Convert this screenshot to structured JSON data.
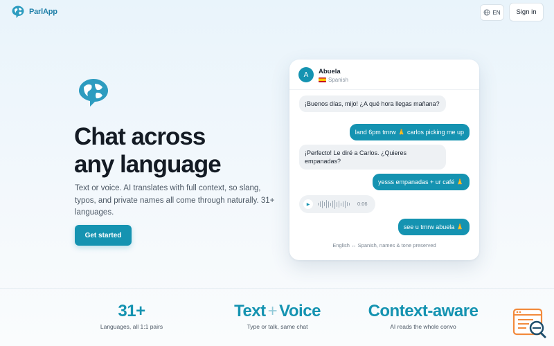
{
  "header": {
    "brand_name": "ParlApp",
    "language_label": "EN",
    "signin_label": "Sign in"
  },
  "hero": {
    "title_line1": "Chat across",
    "title_line2": "any language",
    "subtitle": "Text or voice. AI translates with full context, so slang, typos, and private names all come through naturally. 31+ languages.",
    "cta_label": "Get started"
  },
  "chat": {
    "avatar_letter": "A",
    "contact_name": "Abuela",
    "contact_language": "Spanish",
    "messages": [
      {
        "dir": "in",
        "text": "¡Buenos días, mijo! ¿A qué hora llegas mañana?"
      },
      {
        "dir": "out",
        "text": "land 6pm tmrw 🙏 carlos picking me up"
      },
      {
        "dir": "in",
        "text": "¡Perfecto! Le diré a Carlos. ¿Quieres empanadas?"
      },
      {
        "dir": "out",
        "text": "yesss empanadas + ur café 🙏"
      },
      {
        "dir": "out",
        "text": "see u tmrw abuela 🙏"
      }
    ],
    "voice_duration": "0:06",
    "footer_note": "English ↔ Spanish, names & tone preserved"
  },
  "stats": [
    {
      "value": "31+",
      "label": "Languages, all 1:1 pairs"
    },
    {
      "value_a": "Text",
      "plus": "+",
      "value_b": "Voice",
      "label": "Type or talk, same chat"
    },
    {
      "value": "Context-aware",
      "label": "AI reads the whole convo"
    }
  ],
  "icons": {
    "brand": "globe-speech-bubble-icon",
    "language": "globe-icon",
    "play": "play-icon",
    "help": "document-search-icon"
  },
  "colors": {
    "accent": "#1593b1",
    "brand_text": "#1f7fa8",
    "bubble_in": "#eef1f4",
    "heading": "#141b24"
  }
}
